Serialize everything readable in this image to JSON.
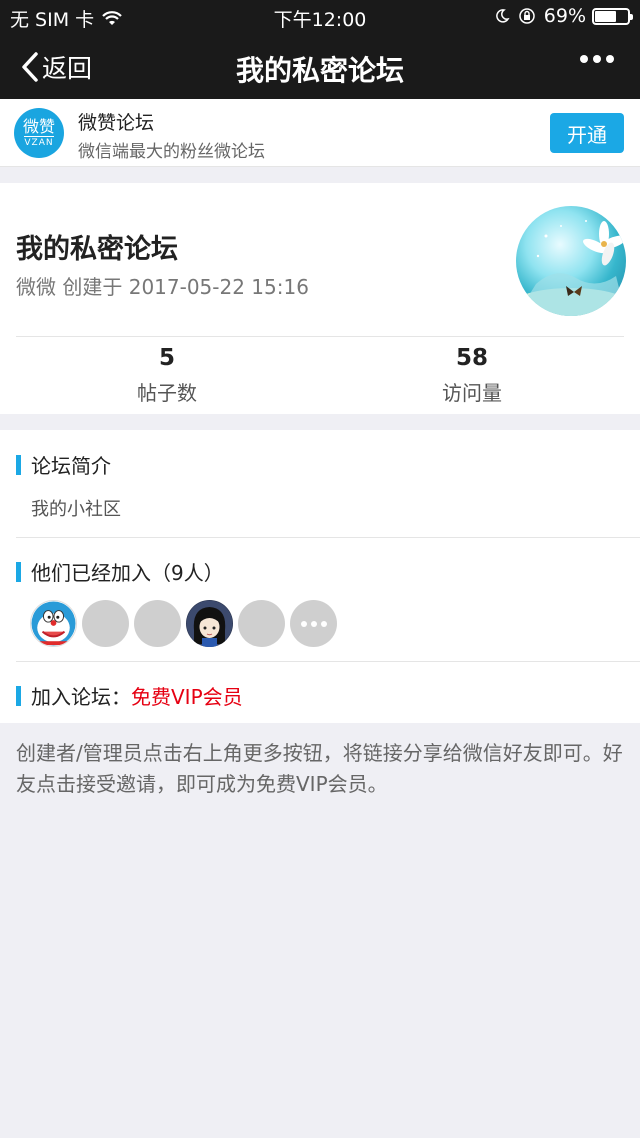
{
  "status_bar": {
    "carrier": "无 SIM 卡",
    "time": "下午12:00",
    "battery_percent": "69%",
    "battery_level": 0.69
  },
  "nav": {
    "back_label": "返回",
    "title": "我的私密论坛",
    "more_icon": "ellipsis-icon"
  },
  "promo": {
    "logo_text": "微赞",
    "logo_subtext": "VZAN",
    "name": "微赞论坛",
    "description": "微信端最大的粉丝微论坛",
    "button_label": "开通",
    "accent_color": "#1ba8e5"
  },
  "forum": {
    "name": "我的私密论坛",
    "meta": "微微 创建于 2017-05-22 15:16",
    "stats": {
      "posts_value": "5",
      "posts_label": "帖子数",
      "visits_value": "58",
      "visits_label": "访问量"
    }
  },
  "intro": {
    "heading": "论坛简介",
    "text": "我的小社区"
  },
  "members": {
    "heading": "他们已经加入（9人）",
    "avatars": [
      "doraemon-avatar",
      "blank-avatar",
      "blank-avatar",
      "anime-girl-avatar",
      "blank-avatar",
      "more-icon"
    ]
  },
  "join": {
    "label": "加入论坛：",
    "value": "免费VIP会员",
    "value_color": "#e60012"
  },
  "footer_note": "创建者/管理员点击右上角更多按钮，将链接分享给微信好友即可。好友点击接受邀请，即可成为免费VIP会员。"
}
